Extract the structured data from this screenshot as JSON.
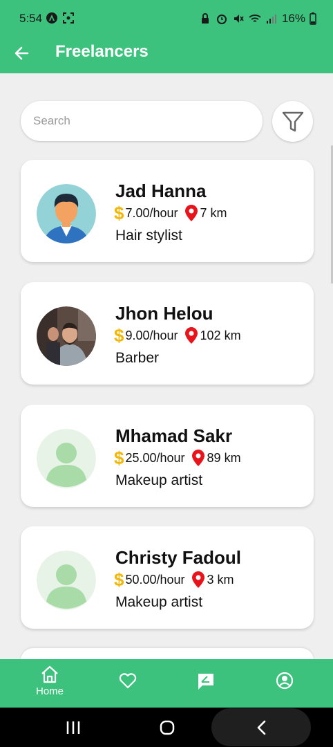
{
  "status_bar": {
    "time": "5:54",
    "battery": "16%"
  },
  "app_bar": {
    "title": "Freelancers"
  },
  "search": {
    "placeholder": "Search"
  },
  "freelancers": [
    {
      "name": "Jad Hanna",
      "rate": "7.00/hour",
      "distance": "7 km",
      "role": "Hair stylist",
      "avatar": "cartoon-man"
    },
    {
      "name": "Jhon Helou",
      "rate": "9.00/hour",
      "distance": "102 km",
      "role": "Barber",
      "avatar": "photo"
    },
    {
      "name": "Mhamad Sakr",
      "rate": "25.00/hour",
      "distance": "89 km",
      "role": "Makeup artist",
      "avatar": "placeholder"
    },
    {
      "name": "Christy Fadoul",
      "rate": "50.00/hour",
      "distance": "3 km",
      "role": "Makeup artist",
      "avatar": "placeholder"
    }
  ],
  "currency_symbol": "$",
  "bottom_nav": {
    "home_label": "Home"
  },
  "colors": {
    "primary": "#3cc27c",
    "accent_dollar": "#f2b705",
    "pin": "#e8141b"
  },
  "icons": [
    "back-arrow-icon",
    "filter-icon",
    "dollar-icon",
    "location-pin-icon",
    "home-icon",
    "heart-icon",
    "chat-edit-icon",
    "account-icon"
  ]
}
